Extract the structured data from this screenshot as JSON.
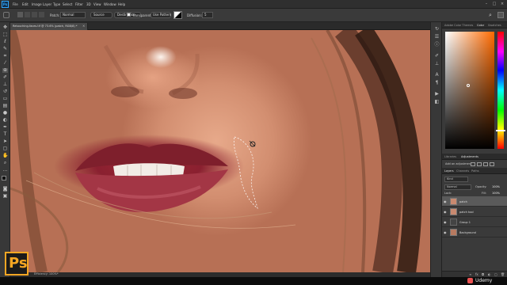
{
  "menu": {
    "items": [
      "File",
      "Edit",
      "Image",
      "Layer",
      "Type",
      "Select",
      "Filter",
      "3D",
      "View",
      "Window",
      "Help"
    ]
  },
  "options_bar": {
    "patch_label": "Patch:",
    "patch_value": "Normal",
    "source_label": "Source",
    "destination_label": "Destination",
    "transparent_label": "Transparent",
    "use_pattern_label": "Use Pattern",
    "diffusion_label": "Diffusion:",
    "diffusion_value": "5"
  },
  "document": {
    "tab_title": "Retouching-faces.tif @ 73.6% (patch, RGB/8) *",
    "zoom": "73.6%",
    "efficiency": "Efficiency: 100%*"
  },
  "color_panel": {
    "tabs": [
      "Adobe Color Themes",
      "Color",
      "Swatches"
    ],
    "active_tab": "Color",
    "picked_color": "#b85a1f"
  },
  "adjustments_panel": {
    "tabs": [
      "Libraries",
      "Adjustments"
    ],
    "active_tab": "Adjustments",
    "hint": "Add an adjustment"
  },
  "layers_panel": {
    "tabs": [
      "Layers",
      "Channels",
      "Paths"
    ],
    "active_tab": "Layers",
    "kind_label": "Kind",
    "blend_mode": "Normal",
    "opacity_label": "Opacity:",
    "opacity_value": "100%",
    "lock_label": "Lock:",
    "fill_label": "Fill:",
    "fill_value": "100%",
    "layers": [
      {
        "name": "patch",
        "selected": true
      },
      {
        "name": "patch tool",
        "selected": false
      },
      {
        "name": "Group 1",
        "selected": false
      },
      {
        "name": "Background",
        "selected": false
      }
    ]
  },
  "branding": {
    "ps_logo": "Ps",
    "udemy": "Udemy"
  },
  "colors": {
    "accent_blue": "#31a8ff",
    "ps_logo_bg": "#1b1b1b",
    "ps_logo_text": "#f5a623",
    "panel_bg": "#3a3a3a"
  }
}
